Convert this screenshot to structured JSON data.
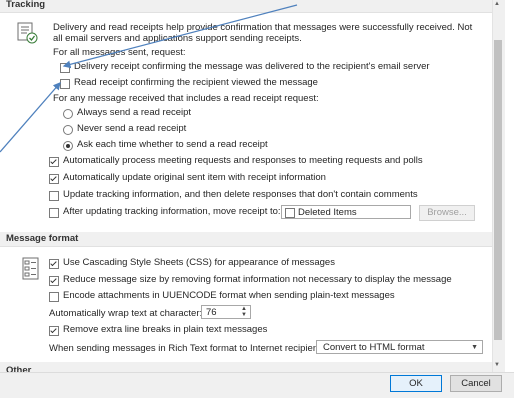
{
  "tracking": {
    "header": "Tracking",
    "description": "Delivery and read receipts help provide confirmation that messages were successfully received. Not all email servers and applications support sending receipts.",
    "for_all_messages_label": "For all messages sent, request:",
    "delivery_receipt_label": "Delivery receipt confirming the message was delivered to the recipient's email server",
    "delivery_receipt_checked": false,
    "read_receipt_label": "Read receipt confirming the recipient viewed the message",
    "read_receipt_checked": false,
    "for_any_message_label": "For any message received that includes a read receipt request:",
    "radio_always": "Always send a read receipt",
    "radio_never": "Never send a read receipt",
    "radio_ask": "Ask each time whether to send a read receipt",
    "radio_selected": "ask",
    "auto_process_label": "Automatically process meeting requests and responses to meeting requests and polls",
    "auto_process_checked": true,
    "auto_update_label": "Automatically update original sent item with receipt information",
    "auto_update_checked": true,
    "update_tracking_label": "Update tracking information, and then delete responses that don't contain comments",
    "update_tracking_checked": false,
    "move_receipt_label": "After updating tracking information, move receipt to:",
    "move_receipt_checked": false,
    "move_receipt_folder": "Deleted Items",
    "browse_label": "Browse..."
  },
  "message_format": {
    "header": "Message format",
    "css_label": "Use Cascading Style Sheets (CSS) for appearance of messages",
    "css_checked": true,
    "reduce_size_label": "Reduce message size by removing format information not necessary to display the message",
    "reduce_size_checked": true,
    "uuencode_label": "Encode attachments in UUENCODE format when sending plain-text messages",
    "uuencode_checked": false,
    "wrap_label": "Automatically wrap text at character:",
    "wrap_value": "76",
    "remove_breaks_label": "Remove extra line breaks in plain text messages",
    "remove_breaks_checked": true,
    "rich_text_label": "When sending messages in Rich Text format to Internet recipients:",
    "rich_text_value": "Convert to HTML format"
  },
  "next_section_header": "Other",
  "footer": {
    "ok_label": "OK",
    "cancel_label": "Cancel"
  },
  "colors": {
    "annotation_arrow": "#4f81bd"
  }
}
